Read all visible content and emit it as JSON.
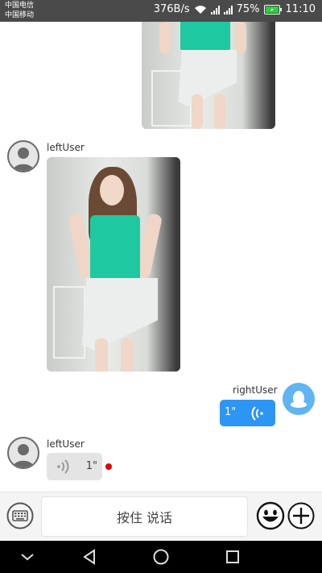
{
  "status_bar": {
    "carrier_1": "中国电信",
    "carrier_2": "中国移动",
    "net_speed": "376B/s",
    "signal_1_label": "2G",
    "signal_2_label": "4G",
    "battery": "75%",
    "time": "11:10"
  },
  "messages": [
    {
      "side": "left",
      "type": "image"
    },
    {
      "side": "left",
      "user": "leftUser",
      "type": "image"
    },
    {
      "side": "right",
      "user": "rightUser",
      "type": "voice",
      "duration": "1\""
    },
    {
      "side": "left",
      "user": "leftUser",
      "type": "voice",
      "duration": "1\"",
      "unread": true
    }
  ],
  "input_bar": {
    "hold_to_talk": "按住 说话",
    "keyboard_icon": "keyboard-icon",
    "emoji_icon": "smiley-icon",
    "plus_icon": "plus-icon"
  },
  "nav_bar": {
    "back_icon": "triangle-back-icon",
    "home_icon": "circle-home-icon",
    "recents_icon": "square-recents-icon",
    "hide_icon": "chevron-down-icon"
  },
  "colors": {
    "status_bar": "#4a4a4a",
    "voice_right_bg": "#2d95f3",
    "voice_left_bg": "#e4e4e4",
    "unread_dot": "#e30000",
    "avatar_right": "#5fb4f2"
  }
}
